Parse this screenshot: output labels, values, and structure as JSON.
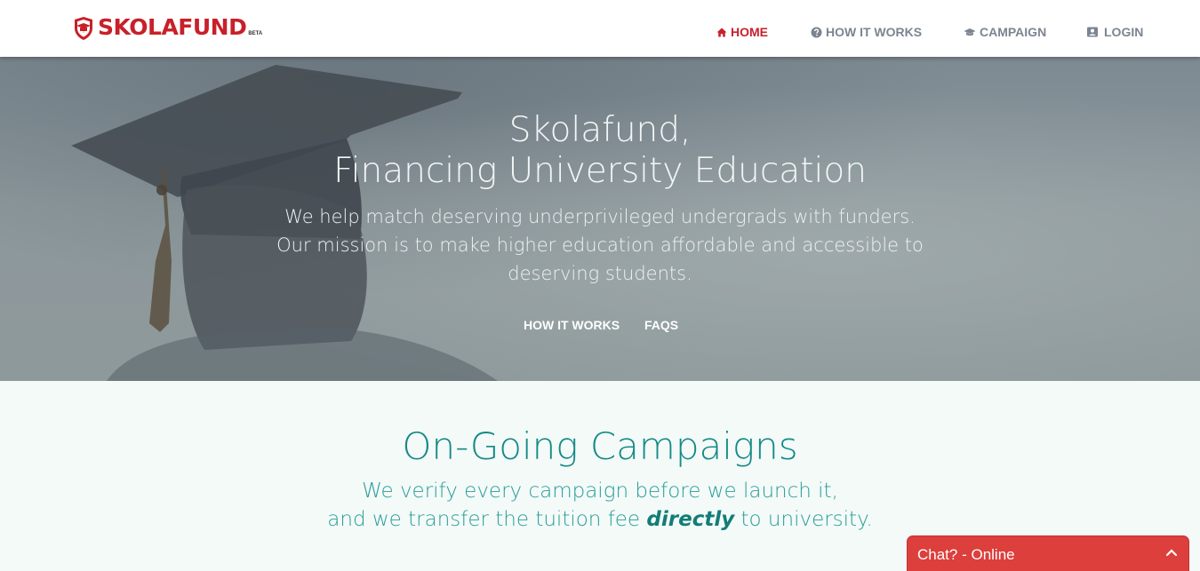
{
  "brand": {
    "name": "SKOLAFUND",
    "badge": "BETA",
    "accent_color": "#c8202a"
  },
  "nav": {
    "items": [
      {
        "label": "HOME",
        "icon": "home-icon",
        "active": true
      },
      {
        "label": "HOW IT WORKS",
        "icon": "question-circle-icon",
        "active": false
      },
      {
        "label": "CAMPAIGN",
        "icon": "graduation-cap-icon",
        "active": false
      },
      {
        "label": "LOGIN",
        "icon": "user-square-icon",
        "active": false
      }
    ]
  },
  "hero": {
    "title_line1": "Skolafund,",
    "title_line2": "Financing University Education",
    "sub_line1": "We help match deserving underprivileged undergrads with funders.",
    "sub_line2": "Our mission is to make higher education affordable and accessible to",
    "sub_line3": "deserving students.",
    "buttons": [
      "HOW IT WORKS",
      "FAQS"
    ]
  },
  "campaigns": {
    "title": "On-Going Campaigns",
    "sub_line1": "We verify every campaign before we launch it,",
    "sub_line2_before": "and we transfer the tuition fee ",
    "sub_line2_emphasis": "directly",
    "sub_line2_after": " to university.",
    "title_color": "#168a86"
  },
  "chat": {
    "label": "Chat? - Online",
    "color": "#dc3f3c",
    "icon": "chevron-up-icon"
  }
}
